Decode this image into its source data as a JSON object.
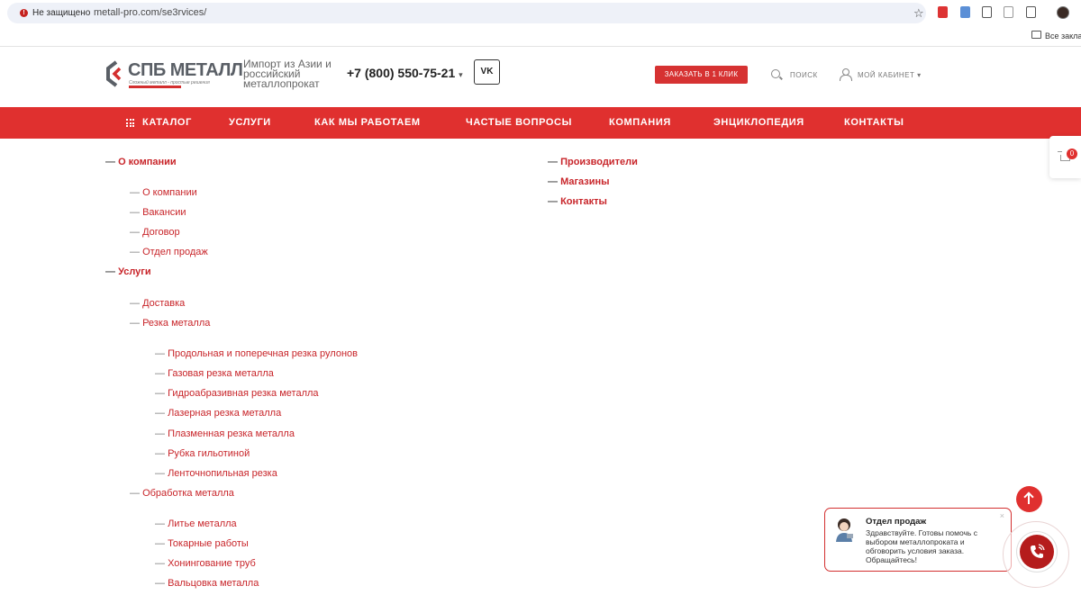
{
  "browser": {
    "security_label": "Не защищено",
    "url": "metall-pro.com/se3rvices/",
    "bookmarks_label": "Все заклад"
  },
  "header": {
    "logo_text": "СПБ МЕТАЛЛ",
    "logo_sub": "Сложный металл - простые решения",
    "tagline": "Импорт из Азии и российский металлопрокат",
    "phone": "+7 (800) 550-75-21",
    "vk": "VK",
    "order_button": "ЗАКАЗАТЬ В 1 КЛИК",
    "search": "ПОИСК",
    "cabinet": "МОЙ КАБИНЕТ"
  },
  "nav": [
    {
      "label": "КАТАЛОГ"
    },
    {
      "label": "УСЛУГИ"
    },
    {
      "label": "КАК МЫ РАБОТАЕМ"
    },
    {
      "label": "ЧАСТЫЕ ВОПРОСЫ"
    },
    {
      "label": "КОМПАНИЯ"
    },
    {
      "label": "ЭНЦИКЛОПЕДИЯ"
    },
    {
      "label": "КОНТАКТЫ"
    }
  ],
  "sitemap_left": [
    {
      "label": "О компании",
      "level": 1
    },
    {
      "label": "О компании",
      "level": 2
    },
    {
      "label": "Вакансии",
      "level": 2
    },
    {
      "label": "Договор",
      "level": 2
    },
    {
      "label": "Отдел продаж",
      "level": 2
    },
    {
      "label": "Услуги",
      "level": 1
    },
    {
      "label": "Доставка",
      "level": 2
    },
    {
      "label": "Резка металла",
      "level": 2
    },
    {
      "label": "Продольная и поперечная резка рулонов",
      "level": 3
    },
    {
      "label": "Газовая резка металла",
      "level": 3
    },
    {
      "label": "Гидроабразивная резка металла",
      "level": 3
    },
    {
      "label": "Лазерная резка металла",
      "level": 3
    },
    {
      "label": "Плазменная резка металла",
      "level": 3
    },
    {
      "label": "Рубка гильотиной",
      "level": 3
    },
    {
      "label": "Ленточнопильная резка",
      "level": 3
    },
    {
      "label": "Обработка металла",
      "level": 2
    },
    {
      "label": "Литье металла",
      "level": 3
    },
    {
      "label": "Токарные работы",
      "level": 3
    },
    {
      "label": "Хонингование труб",
      "level": 3
    },
    {
      "label": "Вальцовка металла",
      "level": 3
    }
  ],
  "sitemap_right": [
    {
      "label": "Производители",
      "level": 1
    },
    {
      "label": "Магазины",
      "level": 1
    },
    {
      "label": "Контакты",
      "level": 1
    }
  ],
  "cart": {
    "count": "0"
  },
  "chat": {
    "close": "×",
    "title": "Отдел продаж",
    "text": "Здравствуйте. Готовы помочь с выбором металлопроката и обговорить условия заказа. Обращайтесь!"
  },
  "colors": {
    "brand_red": "#e0302f",
    "link_red": "#c8252a"
  }
}
